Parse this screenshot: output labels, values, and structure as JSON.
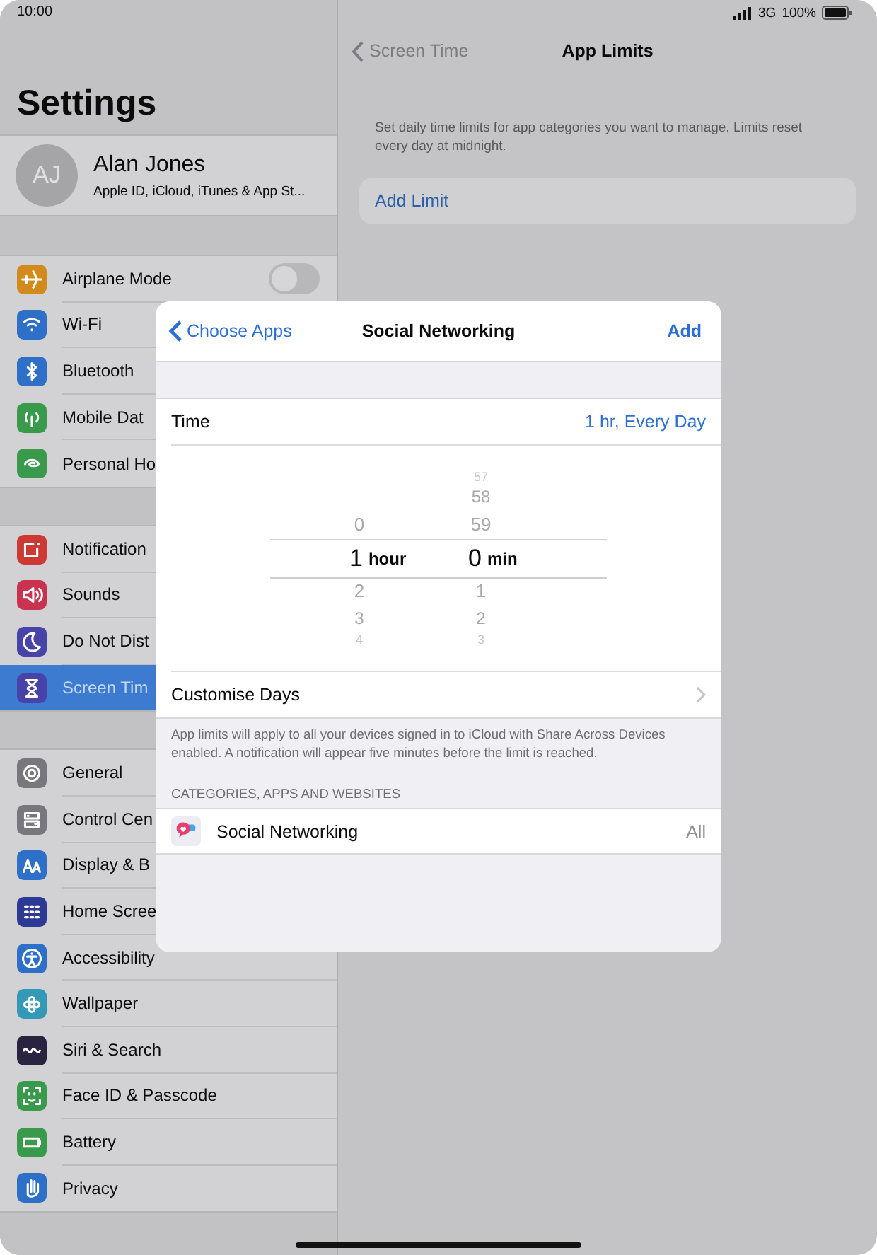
{
  "status_bar": {
    "time": "10:00",
    "network": "3G",
    "battery": "100%"
  },
  "sidebar": {
    "title": "Settings",
    "profile": {
      "initials": "AJ",
      "name": "Alan Jones",
      "subtitle": "Apple ID, iCloud, iTunes & App St..."
    },
    "groups": [
      [
        {
          "label": "Airplane Mode",
          "kind": "toggle",
          "on": false,
          "selected": false
        },
        {
          "label": "Wi-Fi",
          "kind": "link",
          "selected": false
        },
        {
          "label": "Bluetooth",
          "kind": "link",
          "selected": false
        },
        {
          "label": "Mobile Dat",
          "kind": "link",
          "selected": false
        },
        {
          "label": "Personal Ho",
          "kind": "link",
          "selected": false
        }
      ],
      [
        {
          "label": "Notification",
          "kind": "link",
          "selected": false
        },
        {
          "label": "Sounds",
          "kind": "link",
          "selected": false
        },
        {
          "label": "Do Not Dist",
          "kind": "link",
          "selected": false
        },
        {
          "label": "Screen Tim",
          "kind": "link",
          "selected": true
        }
      ],
      [
        {
          "label": "General",
          "kind": "link",
          "selected": false
        },
        {
          "label": "Control Cen",
          "kind": "link",
          "selected": false
        },
        {
          "label": "Display & B",
          "kind": "link",
          "selected": false
        },
        {
          "label": "Home Scree",
          "kind": "link",
          "selected": false
        },
        {
          "label": "Accessibility",
          "kind": "link",
          "selected": false
        },
        {
          "label": "Wallpaper",
          "kind": "link",
          "selected": false
        },
        {
          "label": "Siri & Search",
          "kind": "link",
          "selected": false
        },
        {
          "label": "Face ID & Passcode",
          "kind": "link",
          "selected": false
        },
        {
          "label": "Battery",
          "kind": "link",
          "selected": false
        },
        {
          "label": "Privacy",
          "kind": "link",
          "selected": false
        }
      ]
    ]
  },
  "detail": {
    "back": "Screen Time",
    "title": "App Limits",
    "description": "Set daily time limits for app categories you want to manage. Limits reset every day at midnight.",
    "add_limit": "Add Limit"
  },
  "modal": {
    "back": "Choose Apps",
    "title": "Social Networking",
    "action": "Add",
    "time_row": {
      "label": "Time",
      "value": "1 hr, Every Day"
    },
    "picker": {
      "hours": {
        "above": [
          "0"
        ],
        "selected": "1",
        "unit": "hour",
        "below": [
          "2",
          "3",
          "4"
        ]
      },
      "minutes": {
        "above": [
          "57",
          "58",
          "59"
        ],
        "selected": "0",
        "unit": "min",
        "below": [
          "1",
          "2",
          "3"
        ]
      }
    },
    "customise": "Customise Days",
    "footer": "App limits will apply to all your devices signed in to iCloud with Share Across Devices enabled. A notification will appear five minutes before the limit is reached.",
    "section_header": "CATEGORIES, APPS AND WEBSITES",
    "apps": [
      {
        "label": "Social Networking",
        "value": "All"
      }
    ]
  }
}
